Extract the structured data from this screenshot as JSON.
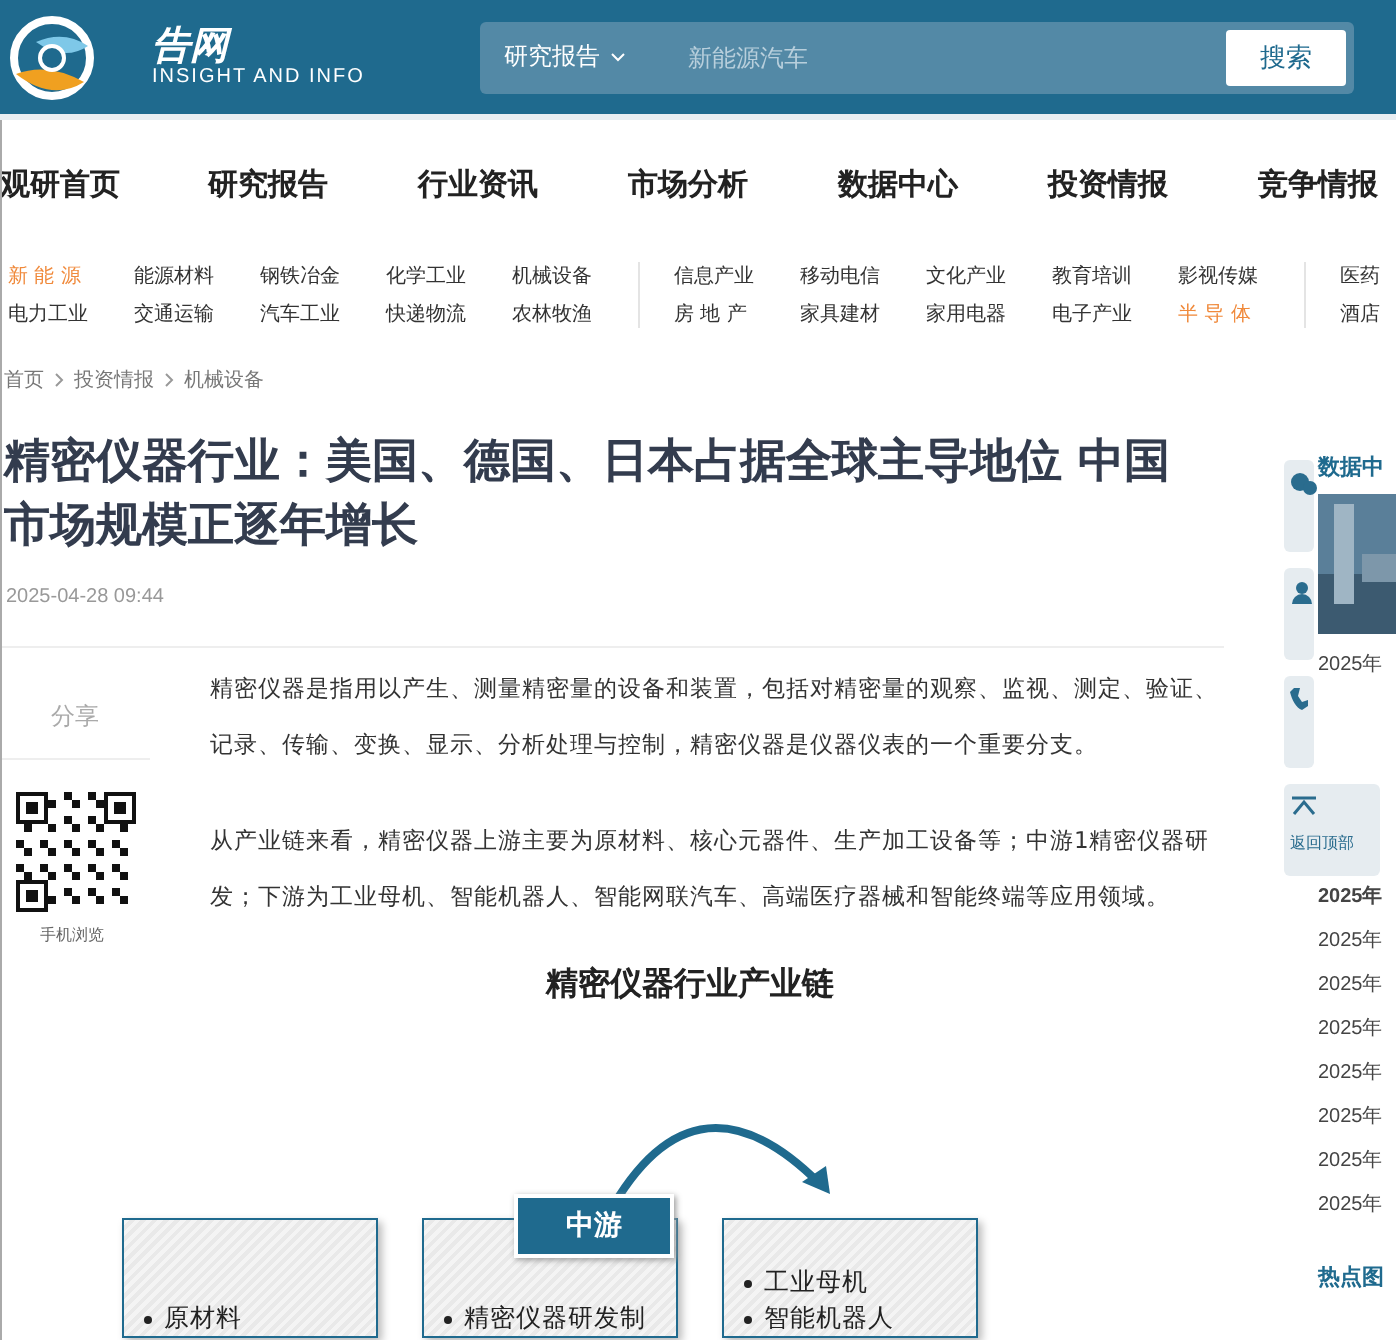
{
  "header": {
    "logo_text": "告网",
    "logo_subtitle": "INSIGHT AND INFO",
    "search_scope": "研究报告",
    "search_placeholder": "新能源汽车",
    "search_button": "搜索"
  },
  "nav": [
    "观研首页",
    "研究报告",
    "行业资讯",
    "市场分析",
    "数据中心",
    "投资情报",
    "竞争情报"
  ],
  "categories": [
    [
      {
        "label": "新 能 源",
        "highlight": true
      },
      {
        "label": "能源材料",
        "highlight": false
      },
      {
        "label": "钢铁冶金",
        "highlight": false
      },
      {
        "label": "化学工业",
        "highlight": false
      },
      {
        "label": "机械设备",
        "highlight": false
      },
      {
        "label": "电力工业",
        "highlight": false
      },
      {
        "label": "交通运输",
        "highlight": false
      },
      {
        "label": "汽车工业",
        "highlight": false
      },
      {
        "label": "快递物流",
        "highlight": false
      },
      {
        "label": "农林牧渔",
        "highlight": false
      }
    ],
    [
      {
        "label": "信息产业",
        "highlight": false
      },
      {
        "label": "移动电信",
        "highlight": false
      },
      {
        "label": "文化产业",
        "highlight": false
      },
      {
        "label": "教育培训",
        "highlight": false
      },
      {
        "label": "影视传媒",
        "highlight": false
      },
      {
        "label": "房 地 产",
        "highlight": false
      },
      {
        "label": "家具建材",
        "highlight": false
      },
      {
        "label": "家用电器",
        "highlight": false
      },
      {
        "label": "电子产业",
        "highlight": false
      },
      {
        "label": "半 导 体",
        "highlight": true
      }
    ],
    [
      {
        "label": "医药",
        "highlight": false
      },
      {
        "label": "酒店",
        "highlight": false
      }
    ]
  ],
  "breadcrumb": [
    "首页",
    "投资情报",
    "机械设备"
  ],
  "article": {
    "title": "精密仪器行业：美国、德国、日本占据全球主导地位 中国市场规模正逐年增长",
    "date": "2025-04-28 09:44",
    "share_label": "分享",
    "qr_caption": "手机浏览",
    "paragraphs": [
      "精密仪器是指用以产生、测量精密量的设备和装置，包括对精密量的观察、监视、测定、验证、记录、传输、变换、显示、分析处理与控制，精密仪器是仪器仪表的一个重要分支。",
      "从产业链来看，精密仪器上游主要为原材料、核心元器件、生产加工设备等；中游1精密仪器研发；下游为工业母机、智能机器人、智能网联汽车、高端医疗器械和智能终端等应用领域。"
    ],
    "figure": {
      "title": "精密仪器行业产业链",
      "boxes": [
        {
          "items": [
            "原材料"
          ]
        },
        {
          "stage": "中游",
          "items": [
            "精密仪器研发制"
          ]
        },
        {
          "items": [
            "工业母机",
            "智能机器人"
          ]
        }
      ]
    }
  },
  "side_tools": [
    {
      "kind": "chat"
    },
    {
      "kind": "user"
    },
    {
      "kind": "phone"
    },
    {
      "kind": "top",
      "label": "返回顶部"
    }
  ],
  "sidebar": {
    "heading": "数据中",
    "caption": "2025年",
    "list": [
      {
        "text": "2025年",
        "bold": true
      },
      {
        "text": "2025年",
        "bold": false
      },
      {
        "text": "2025年",
        "bold": false
      },
      {
        "text": "2025年",
        "bold": false
      },
      {
        "text": "2025年",
        "bold": false
      },
      {
        "text": "2025年",
        "bold": false
      },
      {
        "text": "2025年",
        "bold": false
      },
      {
        "text": "2025年",
        "bold": false
      }
    ],
    "heading_2": "热点图"
  }
}
